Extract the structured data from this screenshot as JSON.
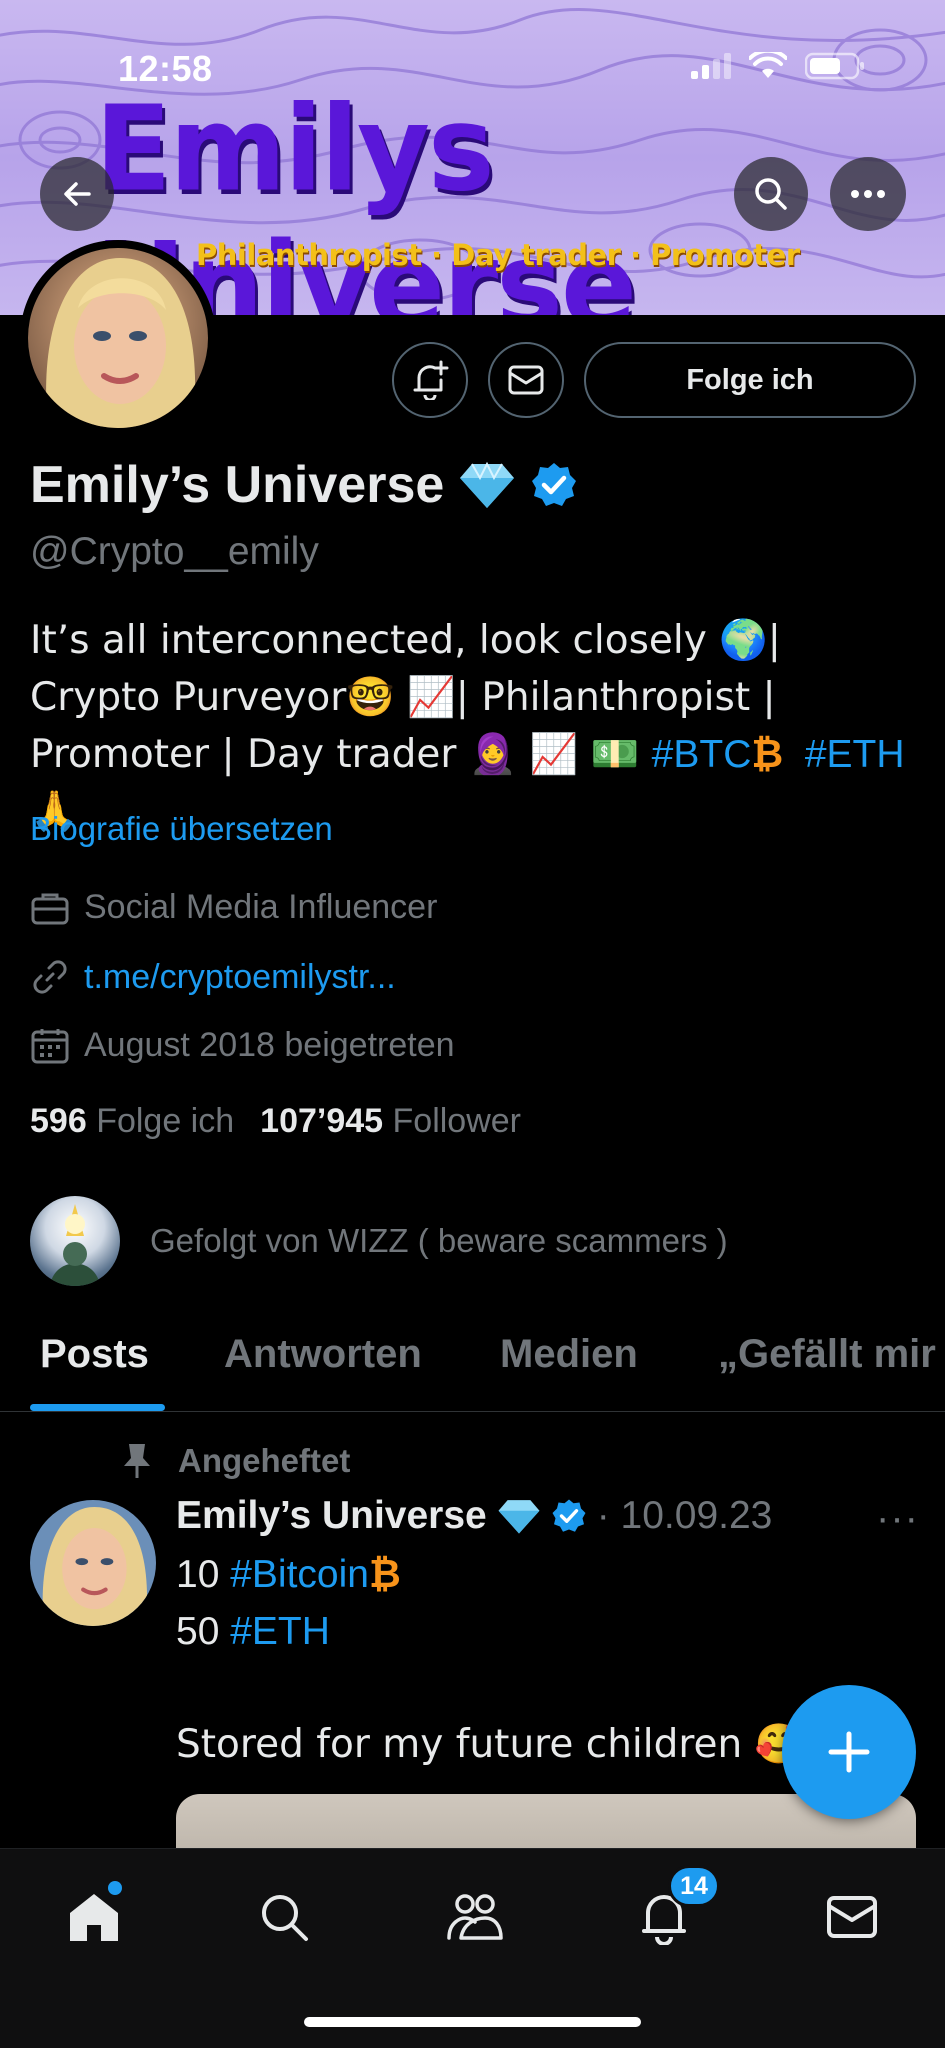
{
  "status_bar": {
    "time": "12:58"
  },
  "banner": {
    "title": "Emilys Universe",
    "subtitle": "Philanthropist · Day trader · Promoter"
  },
  "profile": {
    "follow_button": "Folge ich",
    "display_name": "Emily’s Universe",
    "handle": "@Crypto__emily",
    "bio_segments": {
      "part1": "It’s all interconnected, look closely 🌍| Crypto Purveyor🤓 📈| Philanthropist | Promoter | Day trader 🧕 📈 💵 ",
      "btc": "#BTC",
      "btc_symbol": "₿",
      "eth": "#ETH",
      "end": " 🙏"
    },
    "translate_link": "Biografie übersetzen",
    "category": "Social Media Influencer",
    "link": "t.me/cryptoemilystr...",
    "joined": "August 2018 beigetreten",
    "following_count": "596",
    "following_label": "Folge ich",
    "followers_count": "107’945",
    "followers_label": "Follower",
    "followed_by": "Gefolgt von WIZZ ( beware scammers )"
  },
  "tabs": [
    "Posts",
    "Antworten",
    "Medien",
    "„Gefällt mir"
  ],
  "pinned_post": {
    "pinned_label": "Angeheftet",
    "author": "Emily’s Universe",
    "date": "· 10.09.23",
    "more": "···",
    "line1_prefix": "10 ",
    "line1_tag": "#Bitcoin",
    "line1_suffix": "₿",
    "line2_prefix": "50 ",
    "line2_tag": "#ETH",
    "line3": "Stored for my future children 🥰"
  },
  "bottom_nav": {
    "items": [
      "home-icon",
      "search-icon",
      "communities-icon",
      "notifications-icon",
      "messages-icon"
    ],
    "notification_badge": "14"
  },
  "colors": {
    "accent": "#1d9bf0",
    "background": "#000000",
    "muted": "#71767b",
    "banner_title": "#5a17d9",
    "banner_subtitle": "#f3c019"
  }
}
